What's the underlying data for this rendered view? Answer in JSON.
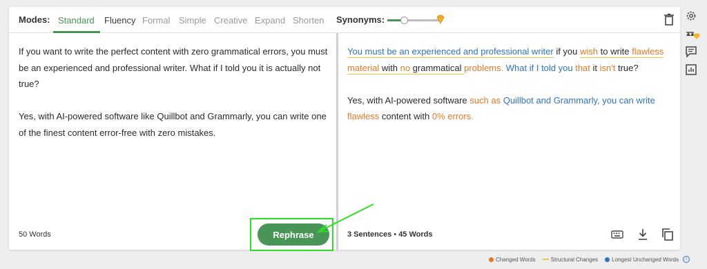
{
  "modes": {
    "label": "Modes:",
    "tabs": [
      {
        "label": "Standard",
        "active": true
      },
      {
        "label": "Fluency",
        "active": false
      },
      {
        "label": "Formal",
        "active": false
      },
      {
        "label": "Simple",
        "active": false
      },
      {
        "label": "Creative",
        "active": false
      },
      {
        "label": "Expand",
        "active": false
      },
      {
        "label": "Shorten",
        "active": false
      }
    ]
  },
  "synonyms": {
    "label": "Synonyms:",
    "level": 0.3
  },
  "left_pane": {
    "paragraph_1": "If you want to write the perfect content with zero grammatical errors, you must be an experienced and professional writer. What if I told you it is actually not true?",
    "paragraph_2": "Yes, with AI-powered software like Quillbot and Grammarly, you can write one of the finest content error-free with zero mistakes.",
    "word_count": "50 Words"
  },
  "right_pane": {
    "p1": {
      "s1": "You must be an experienced and professional writer",
      "s2": " if you ",
      "s3": "wish",
      "s4": " to write ",
      "s5": "flawless material",
      "s6": " with ",
      "s7": "no",
      "s8": " grammatical ",
      "s9": "problems.",
      "s10": " What if I told you ",
      "s11": "that",
      "s12": " it ",
      "s13": "isn't",
      "s14": " true?"
    },
    "p2": {
      "s1": "Yes, with AI-powered software ",
      "s2": "such as",
      "s3": " Quillbot and Grammarly, you can write ",
      "s4": "flawless",
      "s5": " content with ",
      "s6": "0% errors."
    },
    "stats_sentences": "3 Sentences",
    "stats_separator": "•",
    "stats_words": "45 Words"
  },
  "rephrase_label": "Rephrase",
  "legend": {
    "changed": "Changed Words",
    "structural": "Structural Changes",
    "unchanged": "Longest Unchanged Words"
  },
  "colors": {
    "accent": "#499557",
    "changed": "#e07a27",
    "structural": "#f2c23a",
    "unchanged": "#2f72c4",
    "highlight": "#2ee024"
  },
  "icons": [
    "trash-icon",
    "gem-icon",
    "gear-icon",
    "compare-icon",
    "comment-icon",
    "chart-icon",
    "keyboard-icon",
    "download-icon",
    "copy-icon"
  ]
}
